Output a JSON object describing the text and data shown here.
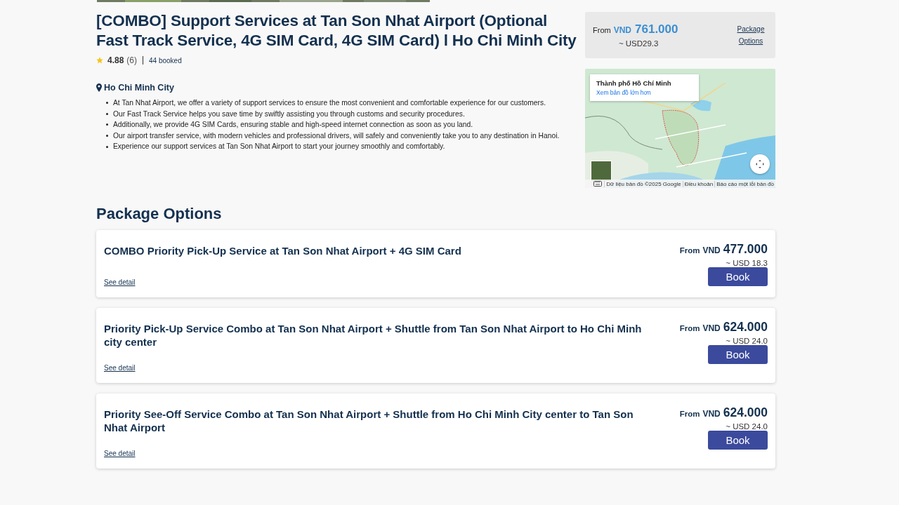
{
  "title": "[COMBO] Support Services at Tan Son Nhat Airport (Optional Fast Track Service, 4G SIM Card, 4G SIM Card) l Ho Chi Minh City",
  "rating": {
    "score": "4.88",
    "count": "(6)",
    "booked": "44 booked"
  },
  "location": "Ho Chi Minh City",
  "highlights": [
    "At Tan Nhat Airport, we offer a variety of support services to ensure the most convenient and comfortable experience for our customers.",
    "Our Fast Track Service helps you save time by swiftly assisting you through customs and security procedures.",
    "Additionally, we provide 4G SIM Cards, ensuring stable and high-speed internet connection as soon as you land.",
    "Our airport transfer service, with modern vehicles and professional drivers, will safely and conveniently take you to any destination in Hanoi.",
    "Experience our support services at Tan Son Nhat Airport to start your journey smoothly and comfortably."
  ],
  "price_box": {
    "from": "From",
    "currency": "VND",
    "amount": "761.000",
    "usd": "~ USD29.3",
    "link": "Package Options"
  },
  "map": {
    "place_title": "Thành phố Hồ Chí Minh",
    "place_link": "Xem bản đồ lớn hơn",
    "attribution": [
      "Dữ liệu bản đồ ©2025 Google",
      "Điều khoản",
      "Báo cáo một lỗi bản đồ"
    ]
  },
  "section_title": "Package Options",
  "packages": [
    {
      "title": "COMBO Priority Pick-Up Service at Tan Son Nhat Airport + 4G SIM Card",
      "from": "From",
      "currency": "VND",
      "price": "477.000",
      "usd": "~ USD 18.3",
      "detail_link": "See detail",
      "button": "Book"
    },
    {
      "title": "Priority Pick-Up Service Combo at Tan Son Nhat Airport + Shuttle from Tan Son Nhat Airport to Ho Chi Minh city center",
      "from": "From",
      "currency": "VND",
      "price": "624.000",
      "usd": "~ USD 24.0",
      "detail_link": "See detail",
      "button": "Book"
    },
    {
      "title": "Priority See-Off Service Combo at Tan Son Nhat Airport + Shuttle from Ho Chi Minh City center to Tan Son Nhat Airport",
      "from": "From",
      "currency": "VND",
      "price": "624.000",
      "usd": "~ USD 24.0",
      "detail_link": "See detail",
      "button": "Book"
    }
  ]
}
